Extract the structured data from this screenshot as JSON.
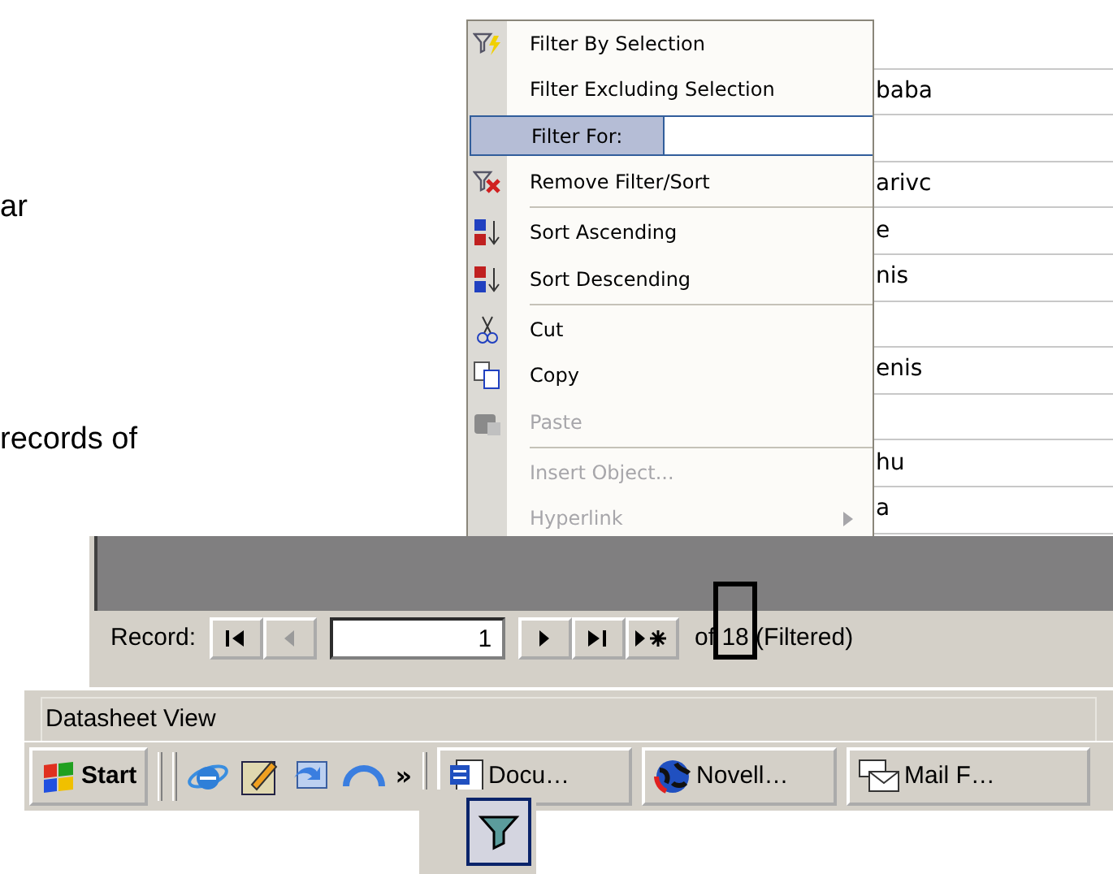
{
  "slide_text": [
    "ar",
    "records of"
  ],
  "datasheet": {
    "rows": [
      {
        "text": ""
      },
      {
        "text": "baba"
      },
      {
        "text": ""
      },
      {
        "text": "arivc"
      },
      {
        "text": "e"
      },
      {
        "text": "nis"
      },
      {
        "text": ""
      },
      {
        "text": "enis"
      },
      {
        "text": ""
      },
      {
        "text": "hu"
      },
      {
        "text": "a"
      }
    ]
  },
  "context_menu": {
    "items": [
      {
        "kind": "command",
        "label": "Filter By Selection",
        "disabled": false,
        "selected": false,
        "separator_before": false
      },
      {
        "kind": "command",
        "label": "Filter Excluding Selection",
        "disabled": false,
        "selected": false,
        "separator_before": false
      },
      {
        "kind": "input",
        "label": "Filter For:",
        "disabled": false,
        "selected": true,
        "separator_before": false
      },
      {
        "kind": "command",
        "label": "Remove Filter/Sort",
        "disabled": false,
        "selected": false,
        "separator_before": false
      },
      {
        "kind": "command",
        "label": "Sort Ascending",
        "disabled": false,
        "selected": false,
        "separator_before": true
      },
      {
        "kind": "command",
        "label": "Sort Descending",
        "disabled": false,
        "selected": false,
        "separator_before": false
      },
      {
        "kind": "command",
        "label": "Cut",
        "disabled": false,
        "selected": false,
        "separator_before": true
      },
      {
        "kind": "command",
        "label": "Copy",
        "disabled": false,
        "selected": false,
        "separator_before": false
      },
      {
        "kind": "command",
        "label": "Paste",
        "disabled": true,
        "selected": false,
        "separator_before": false
      },
      {
        "kind": "command",
        "label": "Insert Object...",
        "disabled": true,
        "selected": false,
        "separator_before": true
      },
      {
        "kind": "submenu",
        "label": "Hyperlink",
        "disabled": true,
        "selected": false,
        "separator_before": false
      }
    ]
  },
  "record_navigator": {
    "label": "Record:",
    "value": "1",
    "total": "of 18 (Filtered)"
  },
  "status_bar": {
    "text": "Datasheet View"
  },
  "taskbar": {
    "start": "Start",
    "overflow": "»",
    "tasks": [
      "Docu…",
      "Novell…",
      "Mail F…"
    ]
  }
}
